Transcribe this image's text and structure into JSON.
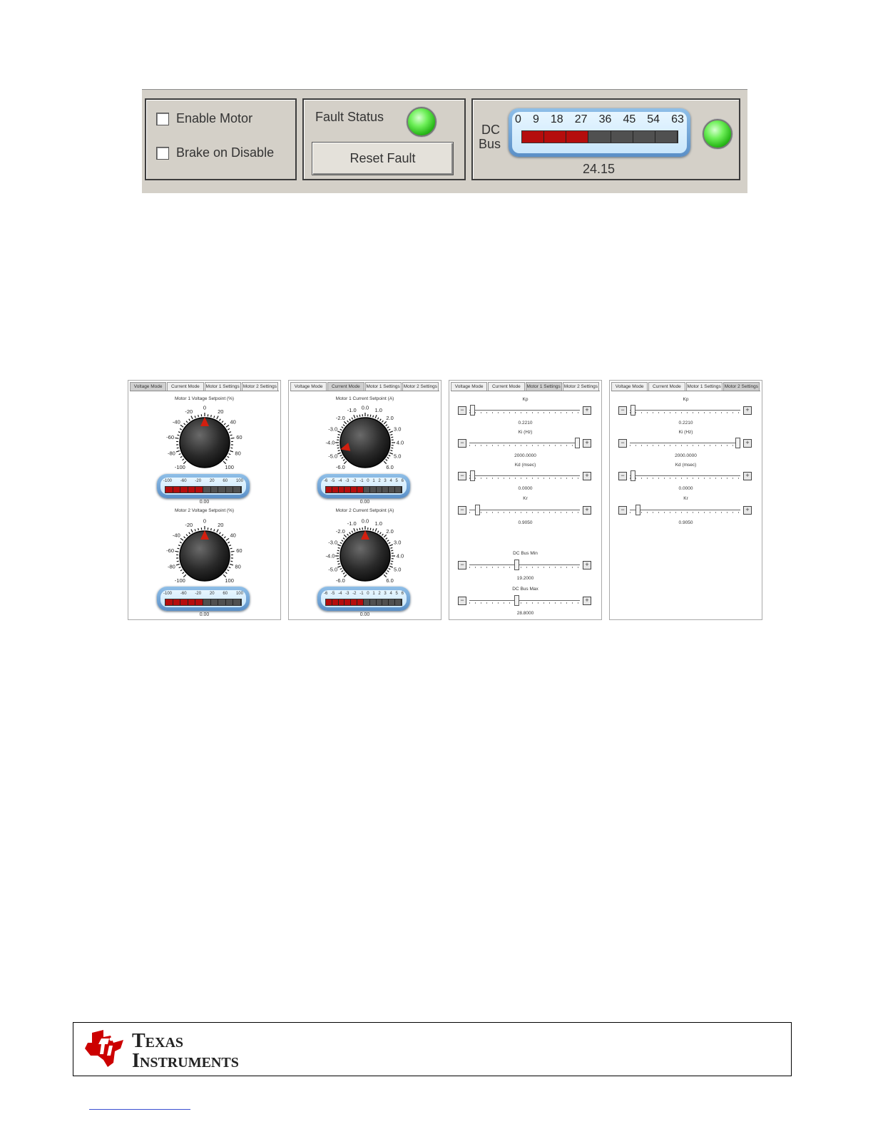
{
  "top": {
    "enable_motor": "Enable Motor",
    "brake_on_disable": "Brake on Disable",
    "fault_status": "Fault Status",
    "reset_fault": "Reset Fault",
    "dc_bus_label_1": "DC",
    "dc_bus_label_2": "Bus",
    "dc_bus_ticks": [
      "0",
      "9",
      "18",
      "27",
      "36",
      "45",
      "54",
      "63"
    ],
    "dc_bus_value": "24.15",
    "dc_bus_level": 24.15,
    "dc_bus_max": 63,
    "led_color": "#3fd42b"
  },
  "tabs": [
    "Voltage Mode",
    "Current Mode",
    "Motor 1 Settings",
    "Motor 2 Settings"
  ],
  "voltage_panel": {
    "m1_title": "Motor 1 Voltage Setpoint (%)",
    "m2_title": "Motor 2 Voltage Setpoint (%)",
    "dial_labels": [
      "-100",
      "-80",
      "-60",
      "-40",
      "-20",
      "0",
      "20",
      "40",
      "60",
      "80",
      "100"
    ],
    "gauge_ticks": [
      "-100",
      "-60",
      "-20",
      "20",
      "60",
      "100"
    ],
    "m1_value": "0.00",
    "m2_value": "0.00"
  },
  "current_panel": {
    "m1_title": "Motor 1 Current Setpoint (A)",
    "m2_title": "Motor 2 Current Setpoint (A)",
    "m1_dial_labels": [
      "-6.0",
      "-5.0",
      "-4.0",
      "-3.0",
      "-2.0",
      "-1.0",
      "0.0",
      "1.0",
      "2.0",
      "3.0",
      "4.0",
      "5.0",
      "6.0"
    ],
    "m2_dial_labels": [
      "-6.0",
      "-5.0",
      "-4.0",
      "-3.0",
      "-2.0",
      "-1.0",
      "0.0",
      "1.0",
      "2.0",
      "3.0",
      "4.0",
      "5.0",
      "6.0"
    ],
    "gauge_ticks": [
      "-6",
      "-5",
      "-4",
      "-3",
      "-2",
      "-1",
      "0",
      "1",
      "2",
      "3",
      "4",
      "5",
      "6"
    ],
    "m1_value": "0.00",
    "m2_value": "0.00"
  },
  "motor1_settings": {
    "kp_label": "Kp",
    "kp_value": "0.2210",
    "ki_label": "Ki (Hz)",
    "ki_value": "2000.0000",
    "kd_label": "Kd (msec)",
    "kd_value": "0.0000",
    "kr_label": "Kr",
    "kr_value": "0.9050",
    "dcmin_label": "DC Bus Min",
    "dcmin_value": "19.2000",
    "dcmax_label": "DC Bus Max",
    "dcmax_value": "28.8000"
  },
  "motor2_settings": {
    "kp_label": "Kp",
    "kp_value": "0.2210",
    "ki_label": "Ki (Hz)",
    "ki_value": "2000.0000",
    "kd_label": "Kd (msec)",
    "kd_value": "0.0000",
    "kr_label": "Kr",
    "kr_value": "0.9050"
  },
  "footer": {
    "brand_line1": "Texas",
    "brand_line2": "Instruments",
    "logo_color": "#cc0000"
  }
}
